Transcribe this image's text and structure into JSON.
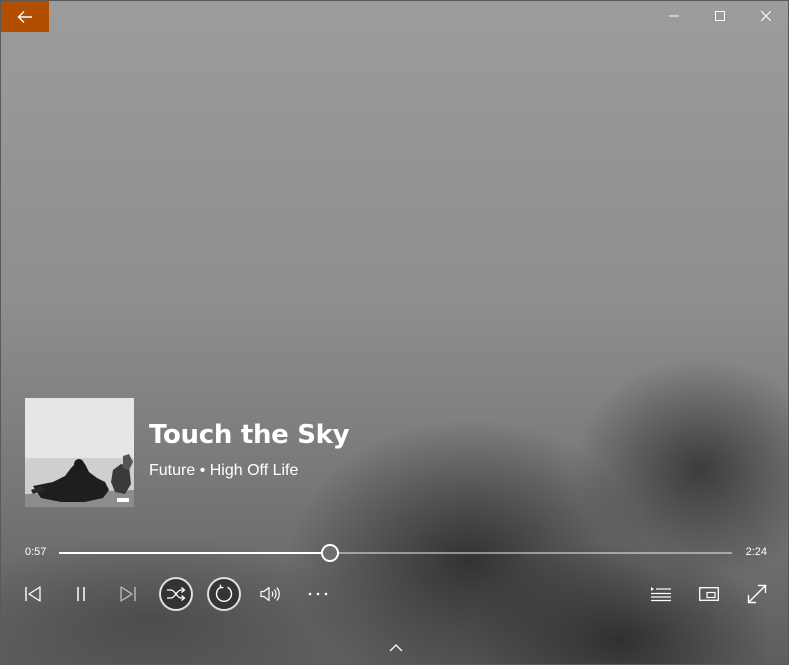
{
  "window": {
    "controls": [
      "minimize-icon",
      "maximize-icon",
      "close-icon"
    ],
    "back_button_color": "#b34d00"
  },
  "now_playing": {
    "title": "Touch the Sky",
    "artist": "Future",
    "separator": " • ",
    "album": "High Off Life"
  },
  "playback": {
    "current_time": "0:57",
    "total_time": "2:24",
    "progress_fraction": 0.403,
    "shuffle_on": true,
    "repeat_on": true
  },
  "controls": {
    "left": [
      "previous-icon",
      "pause-icon",
      "next-icon",
      "shuffle-icon",
      "repeat-icon",
      "volume-icon",
      "more-icon"
    ],
    "right": [
      "now-playing-list-icon",
      "mini-player-icon",
      "full-screen-icon"
    ]
  }
}
